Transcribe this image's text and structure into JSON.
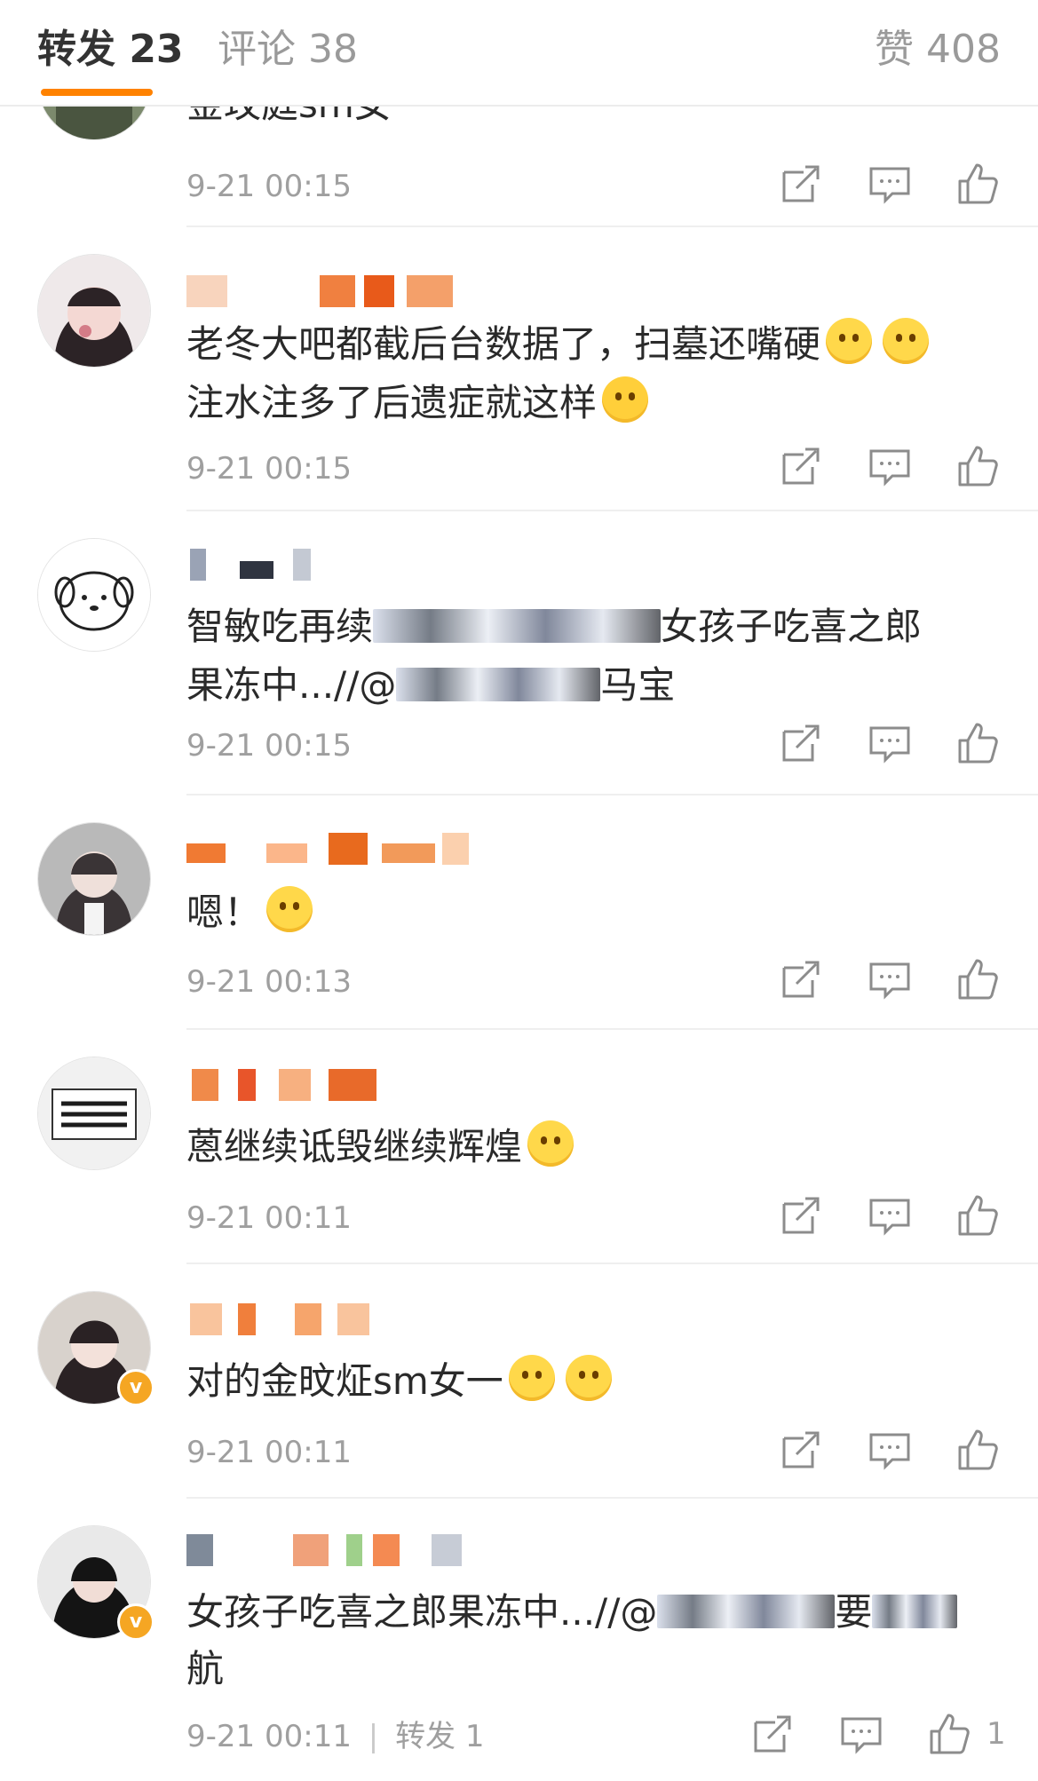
{
  "tabs": {
    "reposts": "转发 23",
    "comments": "评论 38",
    "likes": "赞 408"
  },
  "comments": [
    {
      "text": "金玟庭sm女一",
      "time": "9-21 00:15",
      "username_colors": []
    },
    {
      "text": "老冬大吧都截后台数据了，扫墓还嘴硬",
      "text_2": "注水注多了后遗症就这样",
      "time": "9-21 00:15",
      "username_colors": [
        "#f8b48a",
        "#f07c40",
        "#e85a1a",
        "#f4a06a"
      ]
    },
    {
      "text_a": "智敏吃再续",
      "text_b": "女孩子吃喜之郎",
      "text_c": "果冻中...//@",
      "text_d": "马宝",
      "time": "9-21 00:15",
      "username_colors": [
        "#9aa3b5",
        "#2f3440",
        "#c4c9d3"
      ]
    },
    {
      "text": "嗯！",
      "time": "9-21 00:13",
      "username_colors": [
        "#f07a33",
        "#fbb68a",
        "#e86a1e",
        "#f29a5a",
        "#fbd0ae"
      ]
    },
    {
      "text": "蒽继续诋毁继续辉煌",
      "time": "9-21 00:11",
      "username_colors": [
        "#f08a4a",
        "#e8552a",
        "#f7b080",
        "#e86a2a"
      ]
    },
    {
      "text": "对的金旼炡sm女一",
      "time": "9-21 00:11",
      "username_colors": [
        "#f9c49d",
        "#f07f3c",
        "#f6a56c"
      ]
    },
    {
      "text_a": "女孩子吃喜之郎果冻中...//@",
      "text_b": "要",
      "text_c": "航",
      "time": "9-21 00:11",
      "repost_label": "转发 1",
      "like_count": "1",
      "username_colors": [
        "#7f8a99",
        "#f0a17a",
        "#9fd08b",
        "#f48a52",
        "#c7ccd6"
      ]
    }
  ],
  "colors": {
    "accent": "#ff8200",
    "meta": "#9f9f9f",
    "divider": "#efefef",
    "badge": "#f5a623"
  },
  "icons": [
    "repost-icon",
    "comment-icon",
    "like-icon",
    "verified-badge-icon"
  ]
}
